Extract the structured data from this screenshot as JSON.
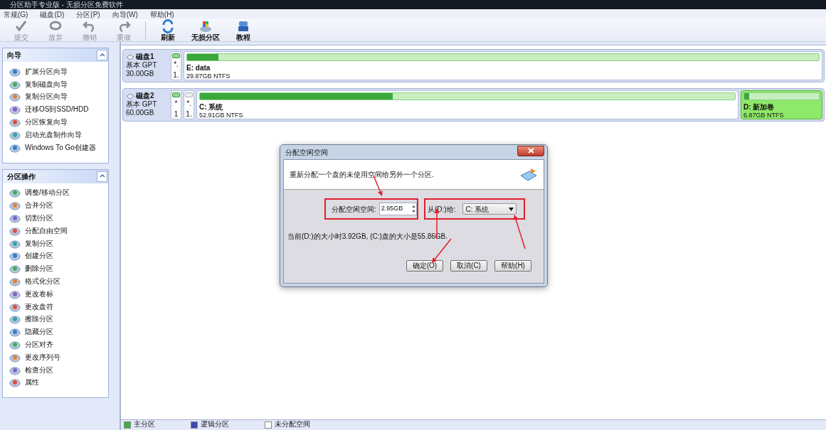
{
  "window": {
    "title": "分区助手专业版 - 无损分区免费软件"
  },
  "menu": [
    "常规(G)",
    "磁盘(D)",
    "分区(P)",
    "向导(W)",
    "帮助(H)"
  ],
  "toolbar": [
    {
      "label": "提交",
      "disabled": true
    },
    {
      "label": "放弃",
      "disabled": true
    },
    {
      "label": "撤销",
      "disabled": true
    },
    {
      "label": "重做",
      "disabled": true
    },
    {
      "label": "刷新",
      "disabled": false
    },
    {
      "label": "无损分区",
      "disabled": false
    },
    {
      "label": "教程",
      "disabled": false
    }
  ],
  "sidebar": [
    {
      "title": "向导",
      "expanded": true,
      "items": [
        "扩展分区向导",
        "复制磁盘向导",
        "复制分区向导",
        "迁移OS到SSD/HDD",
        "分区恢复向导",
        "启动光盘制作向导",
        "Windows To Go创建器"
      ]
    },
    {
      "title": "分区操作",
      "expanded": true,
      "items": [
        "调整/移动分区",
        "合并分区",
        "切割分区",
        "分配自由空间",
        "复制分区",
        "创建分区",
        "删除分区",
        "格式化分区",
        "更改卷标",
        "更改盘符",
        "擦除分区",
        "隐藏分区",
        "分区对齐",
        "更改序列号",
        "检查分区",
        "属性"
      ]
    }
  ],
  "disks": [
    {
      "name": "磁盘1",
      "type": "基本 GPT",
      "size": "30.00GB",
      "partitions": [
        {
          "kind": "stub",
          "formatted": true,
          "line1": "*.",
          "line2": "1."
        },
        {
          "kind": "volume",
          "label": "E: data",
          "detail": "29.87GB NTFS",
          "level": 0.05,
          "selected": false
        }
      ]
    },
    {
      "name": "磁盘2",
      "type": "基本 GPT",
      "size": "60.00GB",
      "partitions": [
        {
          "kind": "stub",
          "formatted": true,
          "line1": "*",
          "line2": "1"
        },
        {
          "kind": "stub",
          "formatted": false,
          "line1": "*.",
          "line2": "1."
        },
        {
          "kind": "volume",
          "label": "C: 系统",
          "detail": "52.91GB NTFS",
          "level": 0.36,
          "selected": false
        },
        {
          "kind": "volume",
          "label": "D: 新加卷",
          "detail": "6.87GB NTFS",
          "level": 0.07,
          "selected": true
        }
      ]
    }
  ],
  "legend": [
    {
      "label": "主分区",
      "color": "#3cb043"
    },
    {
      "label": "逻辑分区",
      "color": "#4048b0"
    },
    {
      "label": "未分配空间",
      "color": "#ffffff"
    }
  ],
  "dialog": {
    "title": "分配空闲空间",
    "description": "重新分配一个盘的未使用空间给另外一个分区.",
    "field_label": "分配空闲空间:",
    "value": "2.95GB",
    "from_label": "从(D:)给:",
    "target": "C: 系统",
    "info": "当前(D:)的大小时3.92GB, (C:)盘的大小是55.86GB.",
    "buttons": [
      "确定(O)",
      "取消(C)",
      "帮助(H)"
    ]
  }
}
